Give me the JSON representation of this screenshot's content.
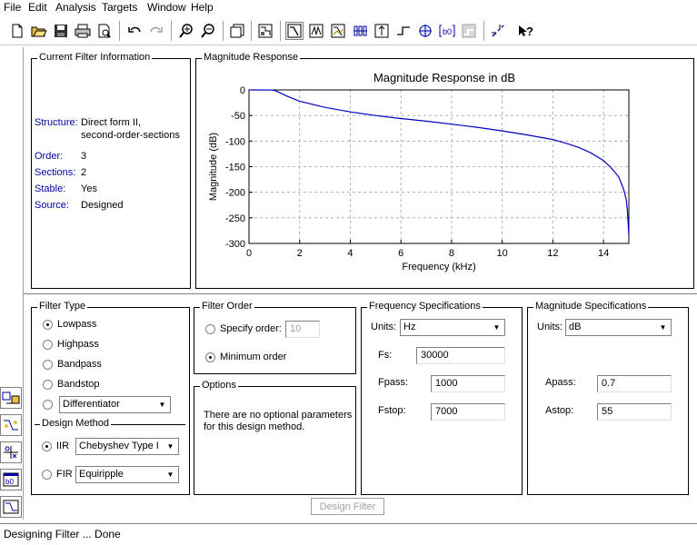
{
  "menu": [
    "File",
    "Edit",
    "Analysis",
    "Targets",
    "Window",
    "Help"
  ],
  "toolbar": {
    "icons": [
      "new-file-icon",
      "open-folder-icon",
      "save-icon",
      "print-icon",
      "print-preview-icon",
      "undo-icon",
      "redo-icon",
      "zoom-in-icon",
      "zoom-out-icon",
      "full-view-icon",
      "filter-specs-icon",
      "magnitude-response-icon",
      "phase-response-icon",
      "magnitude-phase-icon",
      "group-delay-icon",
      "impulse-response-icon",
      "step-response-icon",
      "pole-zero-icon",
      "filter-coefficients-icon",
      "filter-info-icon",
      "legend-icon",
      "whats-this-icon"
    ]
  },
  "filter_info": {
    "title": "Current Filter Information",
    "structure_label": "Structure:",
    "structure_value_1": "Direct form II,",
    "structure_value_2": "second-order-sections",
    "order_label": "Order:",
    "order_value": "3",
    "sections_label": "Sections:",
    "sections_value": "2",
    "stable_label": "Stable:",
    "stable_value": "Yes",
    "source_label": "Source:",
    "source_value": "Designed"
  },
  "magnitude_panel": {
    "title": "Magnitude Response"
  },
  "chart_data": {
    "type": "line",
    "title": "Magnitude Response in dB",
    "xlabel": "Frequency (kHz)",
    "ylabel": "Magnitude (dB)",
    "xlim": [
      0,
      15
    ],
    "ylim": [
      -300,
      0
    ],
    "xticks": [
      0,
      2,
      4,
      6,
      8,
      10,
      12,
      14
    ],
    "yticks": [
      0,
      -50,
      -100,
      -150,
      -200,
      -250,
      -300
    ],
    "grid": true,
    "series": [
      {
        "color": "#0000c0",
        "x": [
          0,
          0.5,
          0.9,
          1.0,
          1.2,
          1.5,
          2,
          3,
          4,
          5,
          6,
          7,
          8,
          9,
          10,
          11,
          12,
          12.5,
          13,
          13.5,
          14,
          14.3,
          14.6,
          14.8,
          14.9,
          14.95,
          15
        ],
        "y": [
          0,
          0,
          -0.3,
          -0.7,
          -5,
          -12,
          -22,
          -34,
          -43,
          -50,
          -56,
          -61,
          -67,
          -73,
          -80,
          -88,
          -97,
          -104,
          -112,
          -123,
          -138,
          -152,
          -170,
          -195,
          -215,
          -240,
          -285
        ]
      }
    ]
  },
  "filter_type": {
    "title": "Filter Type",
    "options": [
      "Lowpass",
      "Highpass",
      "Bandpass",
      "Bandstop"
    ],
    "selected": 0,
    "other_value": "Differentiator"
  },
  "design_method": {
    "title": "Design Method",
    "iir_label": "IIR",
    "iir_value": "Chebyshev Type I",
    "fir_label": "FIR",
    "fir_value": "Equiripple"
  },
  "filter_order": {
    "title": "Filter Order",
    "specify_label": "Specify order:",
    "specify_value": "10",
    "minimum_label": "Minimum order"
  },
  "options": {
    "title": "Options",
    "text_1": "There are no optional parameters",
    "text_2": "for this design method."
  },
  "freq_specs": {
    "title": "Frequency Specifications",
    "units_label": "Units:",
    "units_value": "Hz",
    "fs_label": "Fs:",
    "fs_value": "30000",
    "fpass_label": "Fpass:",
    "fpass_value": "1000",
    "fstop_label": "Fstop:",
    "fstop_value": "7000"
  },
  "mag_specs": {
    "title": "Magnitude Specifications",
    "units_label": "Units:",
    "units_value": "dB",
    "apass_label": "Apass:",
    "apass_value": "0.7",
    "astop_label": "Astop:",
    "astop_value": "55"
  },
  "design_button": "Design Filter",
  "status": "Designing Filter ... Done"
}
